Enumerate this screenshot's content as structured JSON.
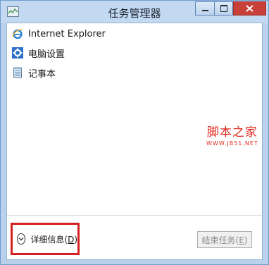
{
  "window": {
    "title": "任务管理器",
    "colors": {
      "titlebar": "#c2d9f1",
      "close_button": "#c7413a",
      "highlight_box": "#d42020",
      "watermark": "#e02a1f"
    }
  },
  "apps": [
    {
      "label": "Internet Explorer",
      "icon": "internet-explorer-icon"
    },
    {
      "label": "电脑设置",
      "icon": "pc-settings-icon"
    },
    {
      "label": "记事本",
      "icon": "notepad-icon"
    }
  ],
  "watermark": {
    "title": "脚本之家",
    "subtitle": "WWW.JB51.NET"
  },
  "footer": {
    "details_label": "详细信息",
    "details_key": "D",
    "end_task_label": "结束任务",
    "end_task_key": "E"
  }
}
